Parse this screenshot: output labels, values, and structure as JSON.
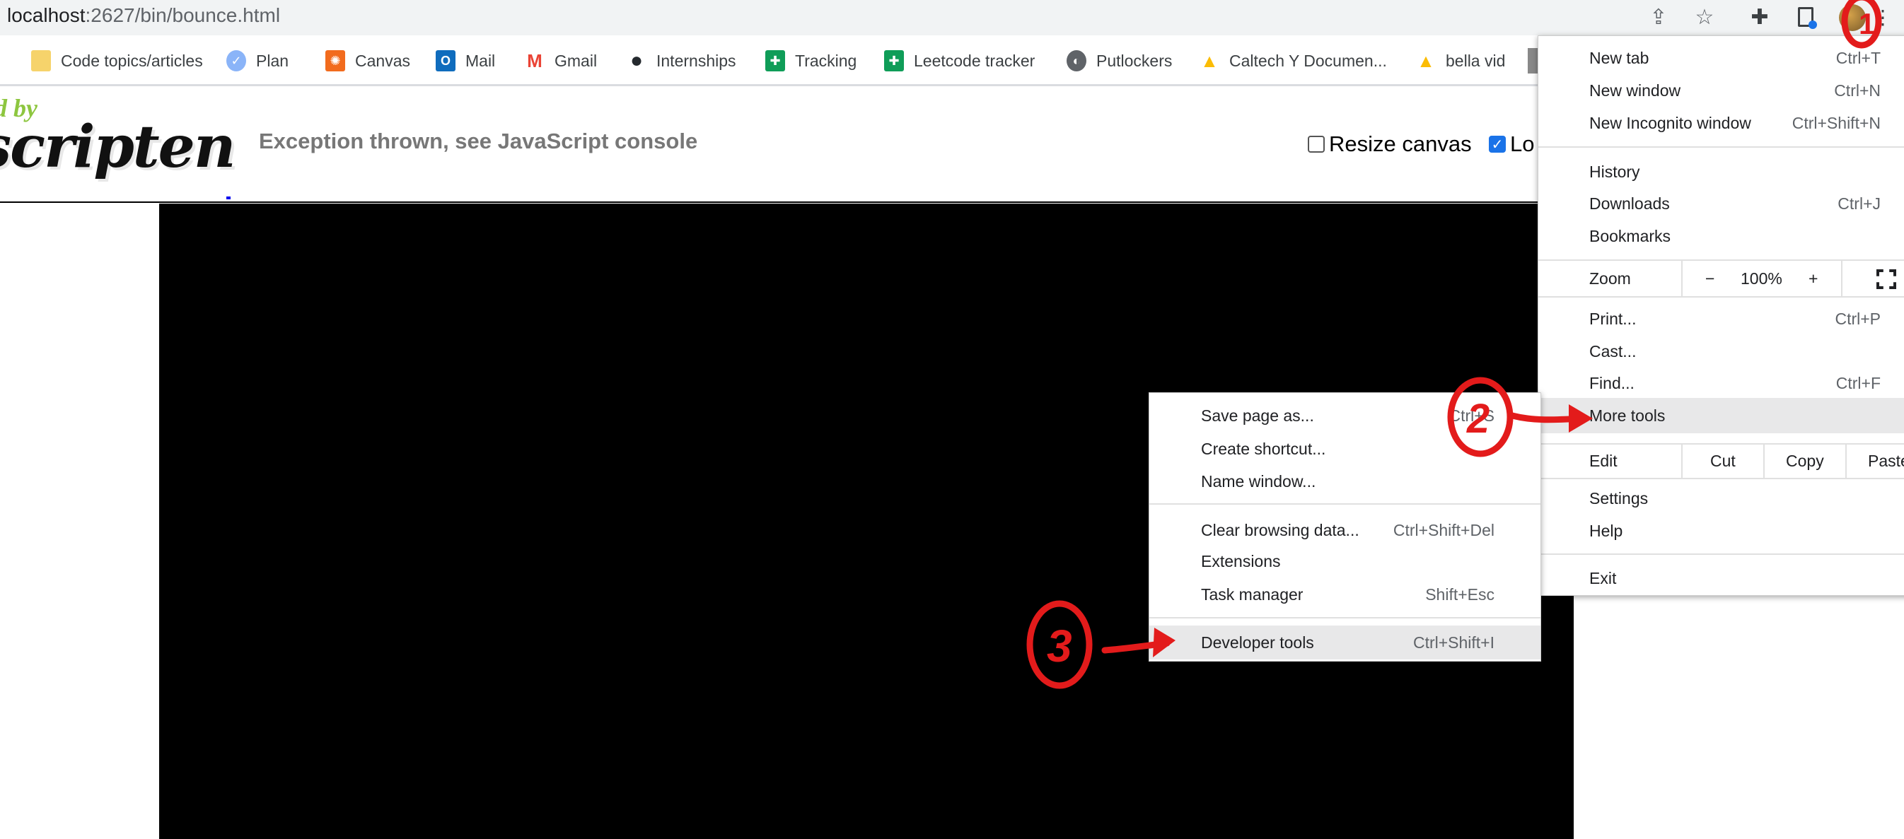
{
  "browser": {
    "url_host": "localhost",
    "url_rest": ":2627/bin/bounce.html",
    "toolbar_icons": [
      "share-icon",
      "star-icon",
      "extensions-puzzle-icon",
      "side-panel-icon",
      "avatar",
      "kebab-menu-icon"
    ]
  },
  "bookmarks": [
    {
      "label": "Code topics/articles",
      "icon": "folder-icon",
      "color": "#f6d36b"
    },
    {
      "label": "Plan",
      "icon": "check-circle-icon",
      "color": "#8ab4f8"
    },
    {
      "label": "Canvas",
      "icon": "canvas-icon",
      "color": "#f26b1d"
    },
    {
      "label": "Mail",
      "icon": "outlook-icon",
      "color": "#0f6cbd"
    },
    {
      "label": "Gmail",
      "icon": "gmail-icon",
      "color": "#ea4335"
    },
    {
      "label": "Internships",
      "icon": "github-icon",
      "color": "#24292e"
    },
    {
      "label": "Tracking",
      "icon": "sheets-icon",
      "color": "#0f9d58"
    },
    {
      "label": "Leetcode tracker",
      "icon": "sheets-icon",
      "color": "#0f9d58"
    },
    {
      "label": "Putlockers",
      "icon": "globe-icon",
      "color": "#5f6368"
    },
    {
      "label": "Caltech Y Documen...",
      "icon": "drive-icon",
      "color": "#fbbc04"
    },
    {
      "label": "bella vid",
      "icon": "drive-icon",
      "color": "#fbbc04"
    }
  ],
  "page": {
    "logo_top": "d by",
    "logo_main": "scripten",
    "status": "Exception thrown, see JavaScript console",
    "resize_canvas": "Resize canvas",
    "lock_pointer": "Lo",
    "resize_checked": false,
    "lock_checked": true
  },
  "menu": {
    "new_tab": "New tab",
    "new_tab_sc": "Ctrl+T",
    "new_window": "New window",
    "new_window_sc": "Ctrl+N",
    "incognito": "New Incognito window",
    "incognito_sc": "Ctrl+Shift+N",
    "history": "History",
    "downloads": "Downloads",
    "downloads_sc": "Ctrl+J",
    "bookmarks": "Bookmarks",
    "zoom": "Zoom",
    "zoom_minus": "−",
    "zoom_value": "100%",
    "zoom_plus": "+",
    "print": "Print...",
    "print_sc": "Ctrl+P",
    "cast": "Cast...",
    "find": "Find...",
    "find_sc": "Ctrl+F",
    "more_tools": "More tools",
    "edit": "Edit",
    "cut": "Cut",
    "copy": "Copy",
    "paste": "Paste",
    "settings": "Settings",
    "help": "Help",
    "exit": "Exit"
  },
  "submenu": {
    "save_page": "Save page as...",
    "save_page_sc": "Ctrl+S",
    "create_shortcut": "Create shortcut...",
    "name_window": "Name window...",
    "clear_data": "Clear browsing data...",
    "clear_data_sc": "Ctrl+Shift+Del",
    "extensions": "Extensions",
    "task_manager": "Task manager",
    "task_manager_sc": "Shift+Esc",
    "dev_tools": "Developer tools",
    "dev_tools_sc": "Ctrl+Shift+I"
  },
  "annotations": {
    "color": "#e31b1b",
    "step1": "1",
    "step2": "2",
    "step3": "3"
  }
}
